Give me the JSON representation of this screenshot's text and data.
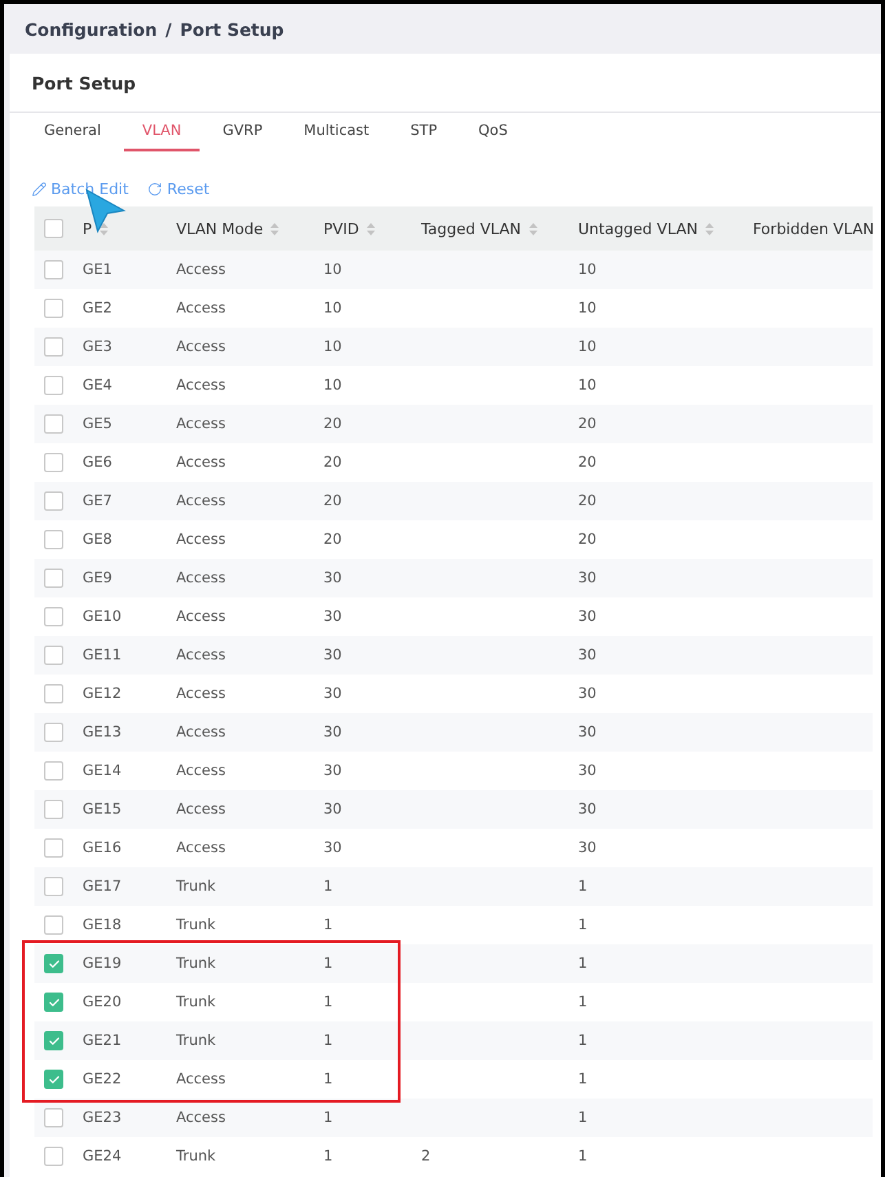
{
  "breadcrumb": [
    "Configuration",
    "Port Setup"
  ],
  "breadcrumb_separator": "/",
  "card_title": "Port Setup",
  "tabs": [
    {
      "label": "General",
      "selected": false
    },
    {
      "label": "VLAN",
      "selected": true
    },
    {
      "label": "GVRP",
      "selected": false
    },
    {
      "label": "Multicast",
      "selected": false
    },
    {
      "label": "STP",
      "selected": false
    },
    {
      "label": "QoS",
      "selected": false
    }
  ],
  "toolbar": [
    {
      "kind": "edit",
      "label": "Batch Edit"
    },
    {
      "kind": "reset",
      "label": "Reset"
    }
  ],
  "table": {
    "select_all_checked": false,
    "columns": [
      "P",
      "VLAN Mode",
      "PVID",
      "Tagged VLAN",
      "Untagged VLAN",
      "Forbidden VLAN"
    ],
    "rows": [
      {
        "checked": false,
        "cells": [
          "GE1",
          "Access",
          "10",
          "",
          "10",
          ""
        ]
      },
      {
        "checked": false,
        "cells": [
          "GE2",
          "Access",
          "10",
          "",
          "10",
          ""
        ]
      },
      {
        "checked": false,
        "cells": [
          "GE3",
          "Access",
          "10",
          "",
          "10",
          ""
        ]
      },
      {
        "checked": false,
        "cells": [
          "GE4",
          "Access",
          "10",
          "",
          "10",
          ""
        ]
      },
      {
        "checked": false,
        "cells": [
          "GE5",
          "Access",
          "20",
          "",
          "20",
          ""
        ]
      },
      {
        "checked": false,
        "cells": [
          "GE6",
          "Access",
          "20",
          "",
          "20",
          ""
        ]
      },
      {
        "checked": false,
        "cells": [
          "GE7",
          "Access",
          "20",
          "",
          "20",
          ""
        ]
      },
      {
        "checked": false,
        "cells": [
          "GE8",
          "Access",
          "20",
          "",
          "20",
          ""
        ]
      },
      {
        "checked": false,
        "cells": [
          "GE9",
          "Access",
          "30",
          "",
          "30",
          ""
        ]
      },
      {
        "checked": false,
        "cells": [
          "GE10",
          "Access",
          "30",
          "",
          "30",
          ""
        ]
      },
      {
        "checked": false,
        "cells": [
          "GE11",
          "Access",
          "30",
          "",
          "30",
          ""
        ]
      },
      {
        "checked": false,
        "cells": [
          "GE12",
          "Access",
          "30",
          "",
          "30",
          ""
        ]
      },
      {
        "checked": false,
        "cells": [
          "GE13",
          "Access",
          "30",
          "",
          "30",
          ""
        ]
      },
      {
        "checked": false,
        "cells": [
          "GE14",
          "Access",
          "30",
          "",
          "30",
          ""
        ]
      },
      {
        "checked": false,
        "cells": [
          "GE15",
          "Access",
          "30",
          "",
          "30",
          ""
        ]
      },
      {
        "checked": false,
        "cells": [
          "GE16",
          "Access",
          "30",
          "",
          "30",
          ""
        ]
      },
      {
        "checked": false,
        "cells": [
          "GE17",
          "Trunk",
          "1",
          "",
          "1",
          ""
        ]
      },
      {
        "checked": false,
        "cells": [
          "GE18",
          "Trunk",
          "1",
          "",
          "1",
          ""
        ]
      },
      {
        "checked": true,
        "cells": [
          "GE19",
          "Trunk",
          "1",
          "",
          "1",
          ""
        ]
      },
      {
        "checked": true,
        "cells": [
          "GE20",
          "Trunk",
          "1",
          "",
          "1",
          ""
        ]
      },
      {
        "checked": true,
        "cells": [
          "GE21",
          "Trunk",
          "1",
          "",
          "1",
          ""
        ]
      },
      {
        "checked": true,
        "cells": [
          "GE22",
          "Access",
          "1",
          "",
          "1",
          ""
        ]
      },
      {
        "checked": false,
        "cells": [
          "GE23",
          "Access",
          "1",
          "",
          "1",
          ""
        ]
      },
      {
        "checked": false,
        "cells": [
          "GE24",
          "Trunk",
          "1",
          "2",
          "1",
          ""
        ]
      }
    ]
  }
}
